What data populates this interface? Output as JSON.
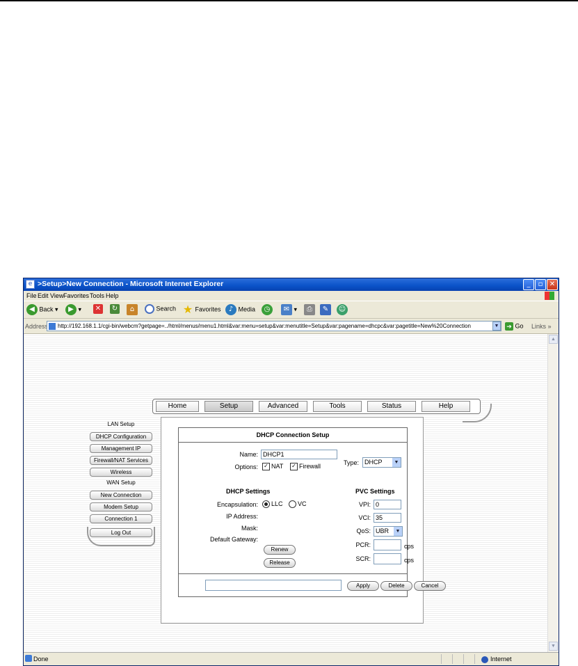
{
  "window": {
    "title": ">Setup>New Connection - Microsoft Internet Explorer",
    "minimize": "_",
    "maximize": "▫",
    "close": "✕"
  },
  "menu": [
    "File",
    "Edit",
    "View",
    "Favorites",
    "Tools",
    "Help"
  ],
  "toolbar": {
    "back": "Back",
    "search": "Search",
    "favorites": "Favorites",
    "media": "Media"
  },
  "address": {
    "label": "Address",
    "url": "http://192.168.1.1/cgi-bin/webcm?getpage=../html/menus/menu1.html&var:menu=setup&var:menutitle=Setup&var:pagename=dhcpc&var:pagetitle=New%20Connection",
    "go": "Go",
    "links": "Links"
  },
  "status": {
    "text": "Done",
    "zone": "Internet"
  },
  "nav": {
    "tabs": [
      "Home",
      "Setup",
      "Advanced",
      "Tools",
      "Status",
      "Help"
    ],
    "active": "Setup"
  },
  "sidebar": {
    "lan_label": "LAN Setup",
    "lan_items": [
      "DHCP Configuration",
      "Management IP",
      "Firewall/NAT Services",
      "Wireless"
    ],
    "wan_label": "WAN Setup",
    "wan_items": [
      "New Connection",
      "Modem Setup",
      "Connection 1"
    ],
    "logout": "Log Out"
  },
  "dialog": {
    "title": "DHCP Connection Setup",
    "name_label": "Name:",
    "name_value": "DHCP1",
    "options_label": "Options:",
    "nat_label": "NAT",
    "nat_checked": true,
    "firewall_label": "Firewall",
    "firewall_checked": true,
    "type_label": "Type:",
    "type_value": "DHCP",
    "dhcp_heading": "DHCP Settings",
    "pvc_heading": "PVC Settings",
    "encapsulation_label": "Encapsulation:",
    "encap_llc": "LLC",
    "encap_vc": "VC",
    "encap_selected": "LLC",
    "ip_label": "IP Address:",
    "mask_label": "Mask:",
    "gateway_label": "Default Gateway:",
    "renew": "Renew",
    "release": "Release",
    "vpi_label": "VPI:",
    "vpi_value": "0",
    "vci_label": "VCI:",
    "vci_value": "35",
    "qos_label": "QoS:",
    "qos_value": "UBR",
    "pcr_label": "PCR:",
    "pcr_value": "",
    "scr_label": "SCR:",
    "scr_value": "",
    "unit": "cps",
    "apply": "Apply",
    "delete": "Delete",
    "cancel": "Cancel",
    "message_value": ""
  }
}
